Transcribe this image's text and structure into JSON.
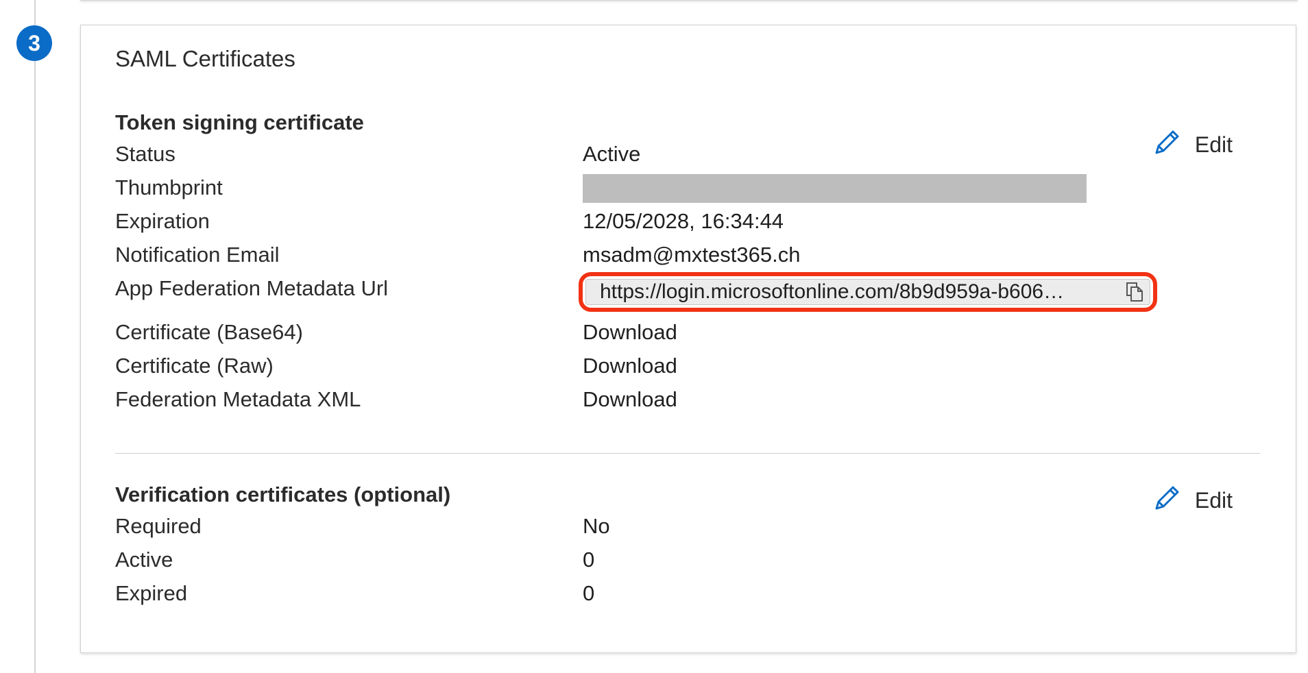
{
  "step": {
    "number": "3"
  },
  "card": {
    "title": "SAML Certificates"
  },
  "token_signing": {
    "heading": "Token signing certificate",
    "edit_label": "Edit",
    "rows": {
      "status": {
        "label": "Status",
        "value": "Active"
      },
      "thumbprint": {
        "label": "Thumbprint"
      },
      "expiration": {
        "label": "Expiration",
        "value": "12/05/2028, 16:34:44"
      },
      "notification_email": {
        "label": "Notification Email",
        "value": "msadm@mxtest365.ch"
      },
      "metadata_url": {
        "label": "App Federation Metadata Url",
        "value": "https://login.microsoftonline.com/8b9d959a-b606…"
      },
      "cert_base64": {
        "label": "Certificate (Base64)",
        "link": "Download"
      },
      "cert_raw": {
        "label": "Certificate (Raw)",
        "link": "Download"
      },
      "federation_xml": {
        "label": "Federation Metadata XML",
        "link": "Download"
      }
    }
  },
  "verification": {
    "heading": "Verification certificates (optional)",
    "edit_label": "Edit",
    "rows": {
      "required": {
        "label": "Required",
        "value": "No"
      },
      "active": {
        "label": "Active",
        "value": "0"
      },
      "expired": {
        "label": "Expired",
        "value": "0"
      }
    }
  },
  "colors": {
    "accent": "#0b6cc7",
    "highlight": "#f13214",
    "redacted": "#bdbdbd"
  },
  "icons": {
    "edit": "pencil-icon",
    "copy": "copy-icon"
  }
}
